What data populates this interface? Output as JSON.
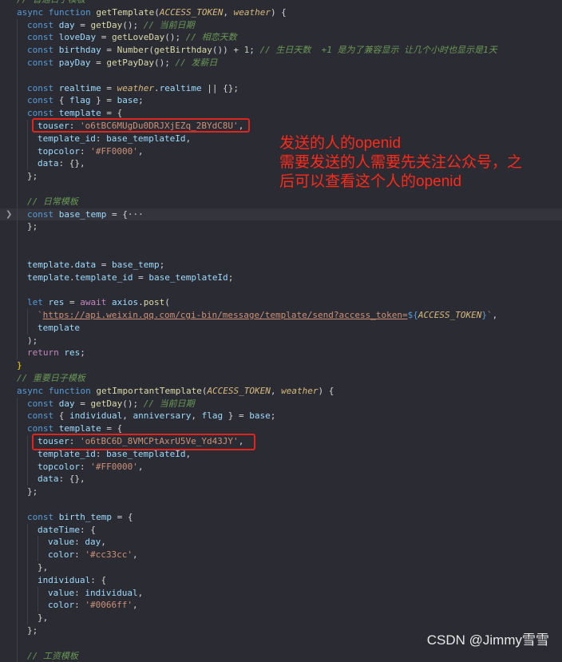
{
  "lines": [
    {
      "indent": 0,
      "tokens": [
        {
          "t": "// 普通日子模板",
          "c": "cm"
        }
      ]
    },
    {
      "indent": 0,
      "tokens": [
        {
          "t": "async ",
          "c": "kw"
        },
        {
          "t": "function ",
          "c": "kw"
        },
        {
          "t": "getTemplate",
          "c": "fn"
        },
        {
          "t": "(",
          "c": "punc"
        },
        {
          "t": "ACCESS_TOKEN",
          "c": "param"
        },
        {
          "t": ", ",
          "c": "punc"
        },
        {
          "t": "weather",
          "c": "param"
        },
        {
          "t": ") {",
          "c": "punc"
        }
      ]
    },
    {
      "indent": 1,
      "tokens": [
        {
          "t": "const ",
          "c": "kw"
        },
        {
          "t": "day",
          "c": "var"
        },
        {
          "t": " = ",
          "c": "punc"
        },
        {
          "t": "getDay",
          "c": "fn"
        },
        {
          "t": "(); ",
          "c": "punc"
        },
        {
          "t": "// 当前日期",
          "c": "cm"
        }
      ]
    },
    {
      "indent": 1,
      "tokens": [
        {
          "t": "const ",
          "c": "kw"
        },
        {
          "t": "loveDay",
          "c": "var"
        },
        {
          "t": " = ",
          "c": "punc"
        },
        {
          "t": "getLoveDay",
          "c": "fn"
        },
        {
          "t": "(); ",
          "c": "punc"
        },
        {
          "t": "// 相恋天数",
          "c": "cm"
        }
      ]
    },
    {
      "indent": 1,
      "tokens": [
        {
          "t": "const ",
          "c": "kw"
        },
        {
          "t": "birthday",
          "c": "var"
        },
        {
          "t": " = ",
          "c": "punc"
        },
        {
          "t": "Number",
          "c": "fn"
        },
        {
          "t": "(",
          "c": "punc"
        },
        {
          "t": "getBirthday",
          "c": "fn"
        },
        {
          "t": "()) + ",
          "c": "punc"
        },
        {
          "t": "1",
          "c": "num"
        },
        {
          "t": "; ",
          "c": "punc"
        },
        {
          "t": "// 生日天数  +1 是为了兼容显示 让几个小时也显示是1天",
          "c": "cm"
        }
      ]
    },
    {
      "indent": 1,
      "tokens": [
        {
          "t": "const ",
          "c": "kw"
        },
        {
          "t": "payDay",
          "c": "var"
        },
        {
          "t": " = ",
          "c": "punc"
        },
        {
          "t": "getPayDay",
          "c": "fn"
        },
        {
          "t": "(); ",
          "c": "punc"
        },
        {
          "t": "// 发薪日",
          "c": "cm"
        }
      ]
    },
    {
      "indent": 1,
      "tokens": []
    },
    {
      "indent": 1,
      "tokens": [
        {
          "t": "const ",
          "c": "kw"
        },
        {
          "t": "realtime",
          "c": "var"
        },
        {
          "t": " = ",
          "c": "punc"
        },
        {
          "t": "weather",
          "c": "param"
        },
        {
          "t": ".",
          "c": "punc"
        },
        {
          "t": "realtime",
          "c": "prop"
        },
        {
          "t": " || {};",
          "c": "punc"
        }
      ]
    },
    {
      "indent": 1,
      "tokens": [
        {
          "t": "const ",
          "c": "kw"
        },
        {
          "t": "{ ",
          "c": "punc"
        },
        {
          "t": "flag",
          "c": "var"
        },
        {
          "t": " } = ",
          "c": "punc"
        },
        {
          "t": "base",
          "c": "var"
        },
        {
          "t": ";",
          "c": "punc"
        }
      ]
    },
    {
      "indent": 1,
      "tokens": [
        {
          "t": "const ",
          "c": "kw"
        },
        {
          "t": "template",
          "c": "var"
        },
        {
          "t": " = {",
          "c": "punc"
        }
      ]
    },
    {
      "indent": 2,
      "tokens": [
        {
          "t": "touser",
          "c": "prop"
        },
        {
          "t": ": ",
          "c": "punc"
        },
        {
          "t": "'o6tBC6MUgDu0DRJXjEZq_2BYdC8U'",
          "c": "str"
        },
        {
          "t": ",",
          "c": "punc"
        }
      ]
    },
    {
      "indent": 2,
      "tokens": [
        {
          "t": "template_id",
          "c": "prop"
        },
        {
          "t": ": ",
          "c": "punc"
        },
        {
          "t": "base_templateId",
          "c": "var"
        },
        {
          "t": ",",
          "c": "punc"
        }
      ]
    },
    {
      "indent": 2,
      "tokens": [
        {
          "t": "topcolor",
          "c": "prop"
        },
        {
          "t": ": ",
          "c": "punc"
        },
        {
          "t": "'#FF0000'",
          "c": "str"
        },
        {
          "t": ",",
          "c": "punc"
        }
      ]
    },
    {
      "indent": 2,
      "tokens": [
        {
          "t": "data",
          "c": "prop"
        },
        {
          "t": ": {},",
          "c": "punc"
        }
      ]
    },
    {
      "indent": 1,
      "tokens": [
        {
          "t": "};",
          "c": "punc"
        }
      ]
    },
    {
      "indent": 1,
      "tokens": []
    },
    {
      "indent": 1,
      "tokens": [
        {
          "t": "// 日常模板",
          "c": "cm"
        }
      ]
    },
    {
      "indent": 1,
      "fold": true,
      "hl": true,
      "tokens": [
        {
          "t": "const ",
          "c": "kw"
        },
        {
          "t": "base_temp",
          "c": "var"
        },
        {
          "t": " = {",
          "c": "punc"
        },
        {
          "t": "···",
          "c": "punc"
        }
      ]
    },
    {
      "indent": 1,
      "tokens": [
        {
          "t": "};",
          "c": "punc"
        }
      ]
    },
    {
      "indent": 1,
      "tokens": []
    },
    {
      "indent": 1,
      "tokens": []
    },
    {
      "indent": 1,
      "tokens": [
        {
          "t": "template",
          "c": "var"
        },
        {
          "t": ".",
          "c": "punc"
        },
        {
          "t": "data",
          "c": "prop"
        },
        {
          "t": " = ",
          "c": "punc"
        },
        {
          "t": "base_temp",
          "c": "var"
        },
        {
          "t": ";",
          "c": "punc"
        }
      ]
    },
    {
      "indent": 1,
      "tokens": [
        {
          "t": "template",
          "c": "var"
        },
        {
          "t": ".",
          "c": "punc"
        },
        {
          "t": "template_id",
          "c": "prop"
        },
        {
          "t": " = ",
          "c": "punc"
        },
        {
          "t": "base_templateId",
          "c": "var"
        },
        {
          "t": ";",
          "c": "punc"
        }
      ]
    },
    {
      "indent": 1,
      "tokens": []
    },
    {
      "indent": 1,
      "tokens": [
        {
          "t": "let ",
          "c": "kw"
        },
        {
          "t": "res",
          "c": "var"
        },
        {
          "t": " = ",
          "c": "punc"
        },
        {
          "t": "await ",
          "c": "kw2"
        },
        {
          "t": "axios",
          "c": "var"
        },
        {
          "t": ".",
          "c": "punc"
        },
        {
          "t": "post",
          "c": "fn"
        },
        {
          "t": "(",
          "c": "punc"
        }
      ]
    },
    {
      "indent": 2,
      "tokens": [
        {
          "t": "`",
          "c": "str"
        },
        {
          "t": "https://api.weixin.qq.com/cgi-bin/message/template/send?access_token=",
          "c": "url"
        },
        {
          "t": "${",
          "c": "kw"
        },
        {
          "t": "ACCESS_TOKEN",
          "c": "tvar"
        },
        {
          "t": "}",
          "c": "kw"
        },
        {
          "t": "`",
          "c": "str"
        },
        {
          "t": ",",
          "c": "punc"
        }
      ]
    },
    {
      "indent": 2,
      "tokens": [
        {
          "t": "template",
          "c": "var"
        }
      ]
    },
    {
      "indent": 1,
      "tokens": [
        {
          "t": ");",
          "c": "punc"
        }
      ]
    },
    {
      "indent": 1,
      "tokens": [
        {
          "t": "return ",
          "c": "kw2"
        },
        {
          "t": "res",
          "c": "var"
        },
        {
          "t": ";",
          "c": "punc"
        }
      ]
    },
    {
      "indent": 0,
      "tokens": [
        {
          "t": "}",
          "c": "brk"
        }
      ]
    },
    {
      "indent": 0,
      "tokens": [
        {
          "t": "// 重要日子模板",
          "c": "cm"
        }
      ]
    },
    {
      "indent": 0,
      "tokens": [
        {
          "t": "async ",
          "c": "kw"
        },
        {
          "t": "function ",
          "c": "kw"
        },
        {
          "t": "getImportantTemplate",
          "c": "fn"
        },
        {
          "t": "(",
          "c": "punc"
        },
        {
          "t": "ACCESS_TOKEN",
          "c": "param"
        },
        {
          "t": ", ",
          "c": "punc"
        },
        {
          "t": "weather",
          "c": "param"
        },
        {
          "t": ") {",
          "c": "punc"
        }
      ]
    },
    {
      "indent": 1,
      "tokens": [
        {
          "t": "const ",
          "c": "kw"
        },
        {
          "t": "day",
          "c": "var"
        },
        {
          "t": " = ",
          "c": "punc"
        },
        {
          "t": "getDay",
          "c": "fn"
        },
        {
          "t": "(); ",
          "c": "punc"
        },
        {
          "t": "// 当前日期",
          "c": "cm"
        }
      ]
    },
    {
      "indent": 1,
      "tokens": [
        {
          "t": "const ",
          "c": "kw"
        },
        {
          "t": "{ ",
          "c": "punc"
        },
        {
          "t": "individual",
          "c": "var"
        },
        {
          "t": ", ",
          "c": "punc"
        },
        {
          "t": "anniversary",
          "c": "var"
        },
        {
          "t": ", ",
          "c": "punc"
        },
        {
          "t": "flag",
          "c": "var"
        },
        {
          "t": " } = ",
          "c": "punc"
        },
        {
          "t": "base",
          "c": "var"
        },
        {
          "t": ";",
          "c": "punc"
        }
      ]
    },
    {
      "indent": 1,
      "tokens": [
        {
          "t": "const ",
          "c": "kw"
        },
        {
          "t": "template",
          "c": "var"
        },
        {
          "t": " = {",
          "c": "punc"
        }
      ]
    },
    {
      "indent": 2,
      "tokens": [
        {
          "t": "touser",
          "c": "prop"
        },
        {
          "t": ": ",
          "c": "punc"
        },
        {
          "t": "'o6tBC6D_8VMCPtAxrU5Ve_Yd43JY'",
          "c": "str"
        },
        {
          "t": ",",
          "c": "punc"
        }
      ]
    },
    {
      "indent": 2,
      "tokens": [
        {
          "t": "template_id",
          "c": "prop"
        },
        {
          "t": ": ",
          "c": "punc"
        },
        {
          "t": "base_templateId",
          "c": "var"
        },
        {
          "t": ",",
          "c": "punc"
        }
      ]
    },
    {
      "indent": 2,
      "tokens": [
        {
          "t": "topcolor",
          "c": "prop"
        },
        {
          "t": ": ",
          "c": "punc"
        },
        {
          "t": "'#FF0000'",
          "c": "str"
        },
        {
          "t": ",",
          "c": "punc"
        }
      ]
    },
    {
      "indent": 2,
      "tokens": [
        {
          "t": "data",
          "c": "prop"
        },
        {
          "t": ": {},",
          "c": "punc"
        }
      ]
    },
    {
      "indent": 1,
      "tokens": [
        {
          "t": "};",
          "c": "punc"
        }
      ]
    },
    {
      "indent": 1,
      "tokens": []
    },
    {
      "indent": 1,
      "tokens": [
        {
          "t": "const ",
          "c": "kw"
        },
        {
          "t": "birth_temp",
          "c": "var"
        },
        {
          "t": " = {",
          "c": "punc"
        }
      ]
    },
    {
      "indent": 2,
      "tokens": [
        {
          "t": "dateTime",
          "c": "prop"
        },
        {
          "t": ": {",
          "c": "punc"
        }
      ]
    },
    {
      "indent": 3,
      "tokens": [
        {
          "t": "value",
          "c": "prop"
        },
        {
          "t": ": ",
          "c": "punc"
        },
        {
          "t": "day",
          "c": "var"
        },
        {
          "t": ",",
          "c": "punc"
        }
      ]
    },
    {
      "indent": 3,
      "tokens": [
        {
          "t": "color",
          "c": "prop"
        },
        {
          "t": ": ",
          "c": "punc"
        },
        {
          "t": "'#cc33cc'",
          "c": "str"
        },
        {
          "t": ",",
          "c": "punc"
        }
      ]
    },
    {
      "indent": 2,
      "tokens": [
        {
          "t": "},",
          "c": "punc"
        }
      ]
    },
    {
      "indent": 2,
      "tokens": [
        {
          "t": "individual",
          "c": "prop"
        },
        {
          "t": ": {",
          "c": "punc"
        }
      ]
    },
    {
      "indent": 3,
      "tokens": [
        {
          "t": "value",
          "c": "prop"
        },
        {
          "t": ": ",
          "c": "punc"
        },
        {
          "t": "individual",
          "c": "var"
        },
        {
          "t": ",",
          "c": "punc"
        }
      ]
    },
    {
      "indent": 3,
      "tokens": [
        {
          "t": "color",
          "c": "prop"
        },
        {
          "t": ": ",
          "c": "punc"
        },
        {
          "t": "'#0066ff'",
          "c": "str"
        },
        {
          "t": ",",
          "c": "punc"
        }
      ]
    },
    {
      "indent": 2,
      "tokens": [
        {
          "t": "},",
          "c": "punc"
        }
      ]
    },
    {
      "indent": 1,
      "tokens": [
        {
          "t": "};",
          "c": "punc"
        }
      ]
    },
    {
      "indent": 1,
      "tokens": []
    },
    {
      "indent": 1,
      "tokens": [
        {
          "t": "// 工资模板",
          "c": "cm"
        }
      ]
    }
  ],
  "annotation": {
    "lines": [
      "发送的人的openid",
      "需要发送的人需要先关注公众号，之",
      "后可以查看这个人的openid"
    ],
    "color": "#ff2a1a"
  },
  "watermark": "CSDN @Jimmy雪雪"
}
